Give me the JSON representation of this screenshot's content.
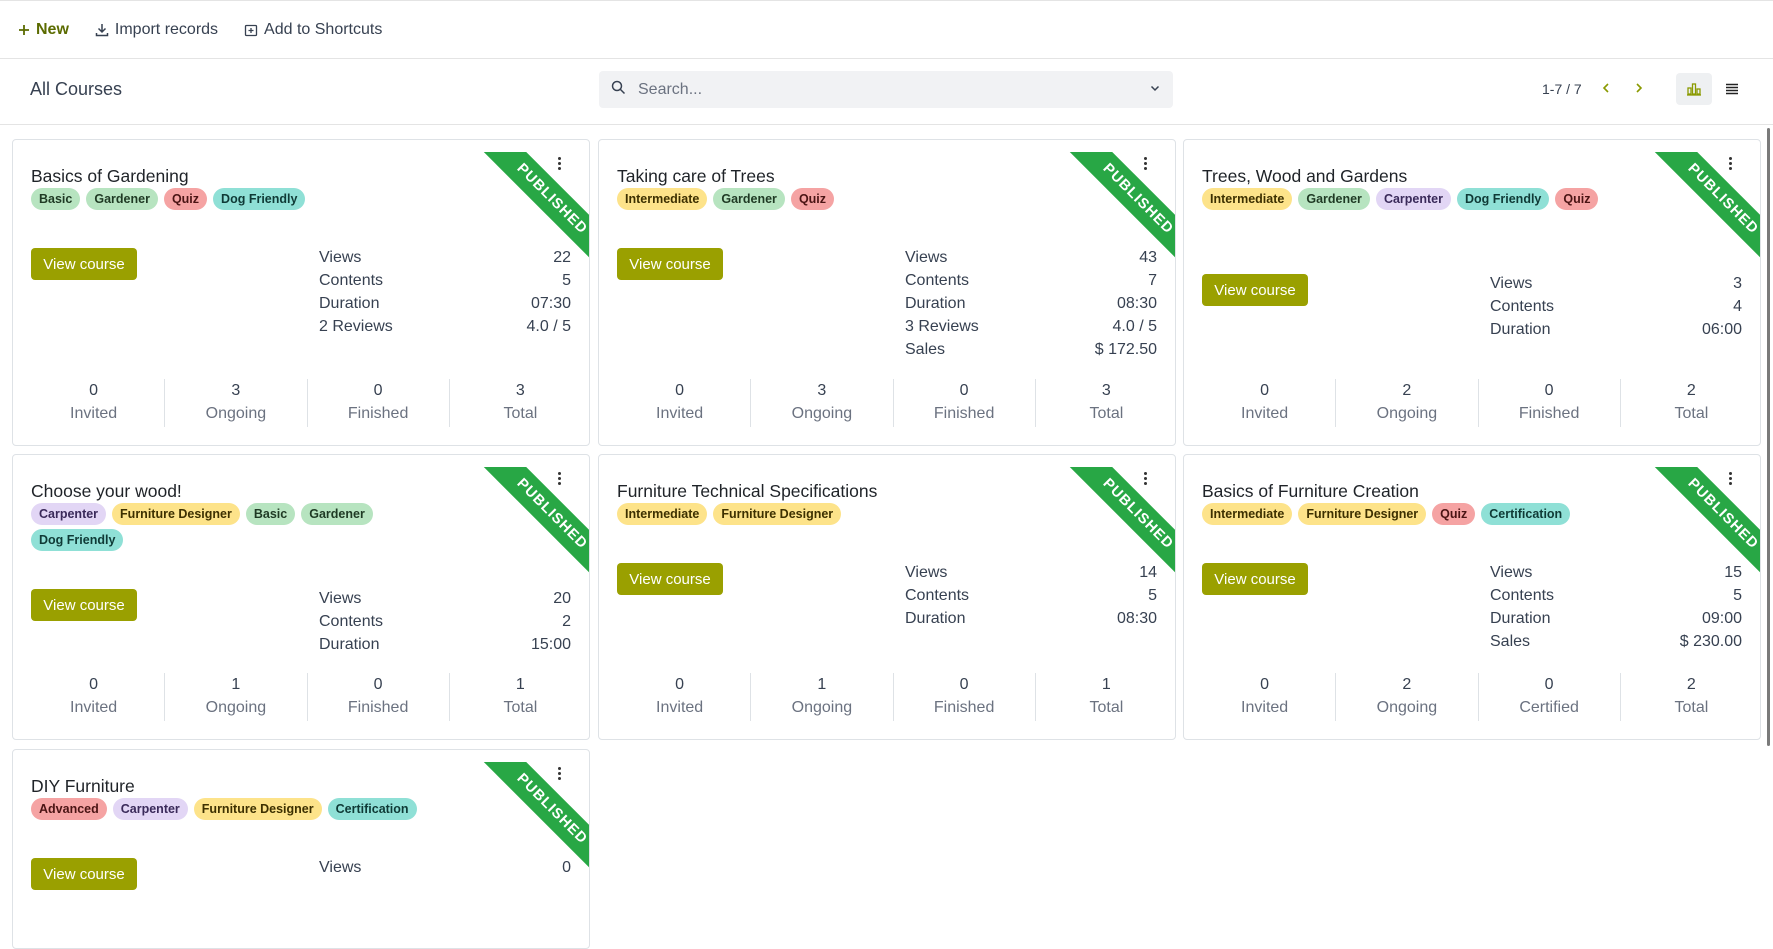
{
  "toolbar": {
    "new_label": "New",
    "import_label": "Import records",
    "shortcuts_label": "Add to Shortcuts"
  },
  "control": {
    "title": "All Courses",
    "search_placeholder": "Search...",
    "pager": "1-7 / 7"
  },
  "ribbon_text": "PUBLISHED",
  "view_course_label": "View course",
  "colors": {
    "accent": "#9aa000",
    "ribbon": "#28a745",
    "tag_green": "#b7e4c0",
    "tag_red": "#f5a3a3",
    "tag_teal": "#8fe0d6",
    "tag_yellow": "#fde38a",
    "tag_purple": "#e2d6f5"
  },
  "cards": [
    {
      "title": "Basics of Gardening",
      "tags": [
        {
          "label": "Basic",
          "color": "green"
        },
        {
          "label": "Gardener",
          "color": "green"
        },
        {
          "label": "Quiz",
          "color": "red"
        },
        {
          "label": "Dog Friendly",
          "color": "teal"
        }
      ],
      "stats": [
        {
          "label": "Views",
          "value": "22"
        },
        {
          "label": "Contents",
          "value": "5"
        },
        {
          "label": "Duration",
          "value": "07:30"
        },
        {
          "label": "2 Reviews",
          "value": "4.0 / 5"
        }
      ],
      "footer": [
        {
          "value": "0",
          "label": "Invited"
        },
        {
          "value": "3",
          "label": "Ongoing"
        },
        {
          "value": "0",
          "label": "Finished"
        },
        {
          "value": "3",
          "label": "Total"
        }
      ]
    },
    {
      "title": "Taking care of Trees",
      "tags": [
        {
          "label": "Intermediate",
          "color": "yellow"
        },
        {
          "label": "Gardener",
          "color": "green"
        },
        {
          "label": "Quiz",
          "color": "red"
        }
      ],
      "stats": [
        {
          "label": "Views",
          "value": "43"
        },
        {
          "label": "Contents",
          "value": "7"
        },
        {
          "label": "Duration",
          "value": "08:30"
        },
        {
          "label": "3 Reviews",
          "value": "4.0 / 5"
        },
        {
          "label": "Sales",
          "value": "$ 172.50"
        }
      ],
      "footer": [
        {
          "value": "0",
          "label": "Invited"
        },
        {
          "value": "3",
          "label": "Ongoing"
        },
        {
          "value": "0",
          "label": "Finished"
        },
        {
          "value": "3",
          "label": "Total"
        }
      ]
    },
    {
      "title": "Trees, Wood and Gardens",
      "tags": [
        {
          "label": "Intermediate",
          "color": "yellow"
        },
        {
          "label": "Gardener",
          "color": "green"
        },
        {
          "label": "Carpenter",
          "color": "purple"
        },
        {
          "label": "Dog Friendly",
          "color": "teal"
        },
        {
          "label": "Quiz",
          "color": "red"
        }
      ],
      "stats": [
        {
          "label": "Views",
          "value": "3"
        },
        {
          "label": "Contents",
          "value": "4"
        },
        {
          "label": "Duration",
          "value": "06:00"
        }
      ],
      "footer": [
        {
          "value": "0",
          "label": "Invited"
        },
        {
          "value": "2",
          "label": "Ongoing"
        },
        {
          "value": "0",
          "label": "Finished"
        },
        {
          "value": "2",
          "label": "Total"
        }
      ]
    },
    {
      "title": "Choose your wood!",
      "tags": [
        {
          "label": "Carpenter",
          "color": "purple"
        },
        {
          "label": "Furniture Designer",
          "color": "yellow"
        },
        {
          "label": "Basic",
          "color": "green"
        },
        {
          "label": "Gardener",
          "color": "green"
        },
        {
          "label": "Dog Friendly",
          "color": "teal"
        }
      ],
      "stats": [
        {
          "label": "Views",
          "value": "20"
        },
        {
          "label": "Contents",
          "value": "2"
        },
        {
          "label": "Duration",
          "value": "15:00"
        }
      ],
      "footer": [
        {
          "value": "0",
          "label": "Invited"
        },
        {
          "value": "1",
          "label": "Ongoing"
        },
        {
          "value": "0",
          "label": "Finished"
        },
        {
          "value": "1",
          "label": "Total"
        }
      ]
    },
    {
      "title": "Furniture Technical Specifications",
      "tags": [
        {
          "label": "Intermediate",
          "color": "yellow"
        },
        {
          "label": "Furniture Designer",
          "color": "yellow"
        }
      ],
      "stats": [
        {
          "label": "Views",
          "value": "14"
        },
        {
          "label": "Contents",
          "value": "5"
        },
        {
          "label": "Duration",
          "value": "08:30"
        }
      ],
      "footer": [
        {
          "value": "0",
          "label": "Invited"
        },
        {
          "value": "1",
          "label": "Ongoing"
        },
        {
          "value": "0",
          "label": "Finished"
        },
        {
          "value": "1",
          "label": "Total"
        }
      ]
    },
    {
      "title": "Basics of Furniture Creation",
      "tags": [
        {
          "label": "Intermediate",
          "color": "yellow"
        },
        {
          "label": "Furniture Designer",
          "color": "yellow"
        },
        {
          "label": "Quiz",
          "color": "red"
        },
        {
          "label": "Certification",
          "color": "teal"
        }
      ],
      "stats": [
        {
          "label": "Views",
          "value": "15"
        },
        {
          "label": "Contents",
          "value": "5"
        },
        {
          "label": "Duration",
          "value": "09:00"
        },
        {
          "label": "Sales",
          "value": "$ 230.00"
        }
      ],
      "footer": [
        {
          "value": "0",
          "label": "Invited"
        },
        {
          "value": "2",
          "label": "Ongoing"
        },
        {
          "value": "0",
          "label": "Certified"
        },
        {
          "value": "2",
          "label": "Total"
        }
      ]
    },
    {
      "title": "DIY Furniture",
      "tags": [
        {
          "label": "Advanced",
          "color": "red"
        },
        {
          "label": "Carpenter",
          "color": "purple"
        },
        {
          "label": "Furniture Designer",
          "color": "yellow"
        },
        {
          "label": "Certification",
          "color": "teal"
        }
      ],
      "stats": [
        {
          "label": "Views",
          "value": "0"
        }
      ],
      "footer": []
    }
  ]
}
